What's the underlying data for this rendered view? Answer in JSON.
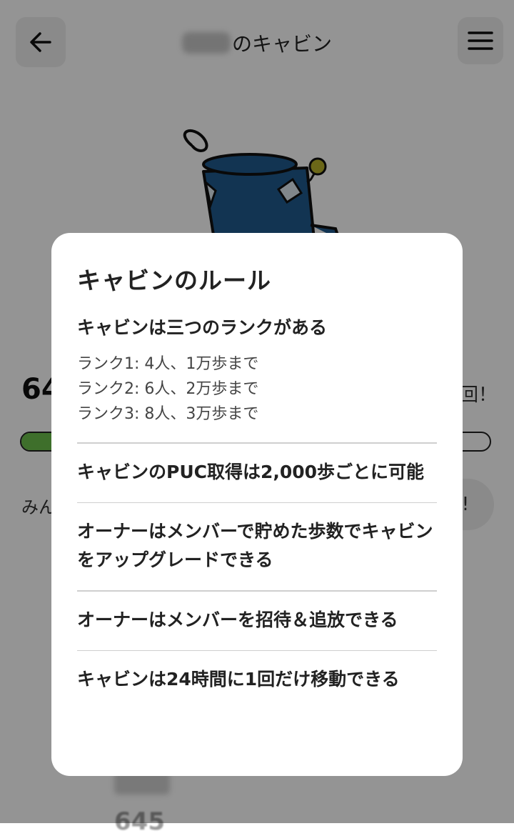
{
  "header": {
    "title_suffix": "のキャビン",
    "back_icon": "arrow-left-icon",
    "menu_icon": "hamburger-menu-icon"
  },
  "background": {
    "steps_partial": "64",
    "right_partial": "回！",
    "minna_partial": "みん",
    "pill_partial": "!",
    "bottom_number": "645",
    "progress_fraction": 0.1,
    "accent_color": "#6cc04a"
  },
  "modal": {
    "title": "キャビンのルール",
    "ranks_heading": "キャビンは三つのランクがある",
    "ranks": [
      "ランク1: 4人、1万歩まで",
      "ランク2: 6人、2万歩まで",
      "ランク3: 8人、3万歩まで"
    ],
    "rules": [
      "キャビンのPUC取得は2,000歩ごとに可能",
      "オーナーはメンバーで貯めた歩数でキャビンをアップグレードできる",
      "オーナーはメンバーを招待＆追放できる",
      "キャビンは24時間に1回だけ移動できる"
    ]
  }
}
